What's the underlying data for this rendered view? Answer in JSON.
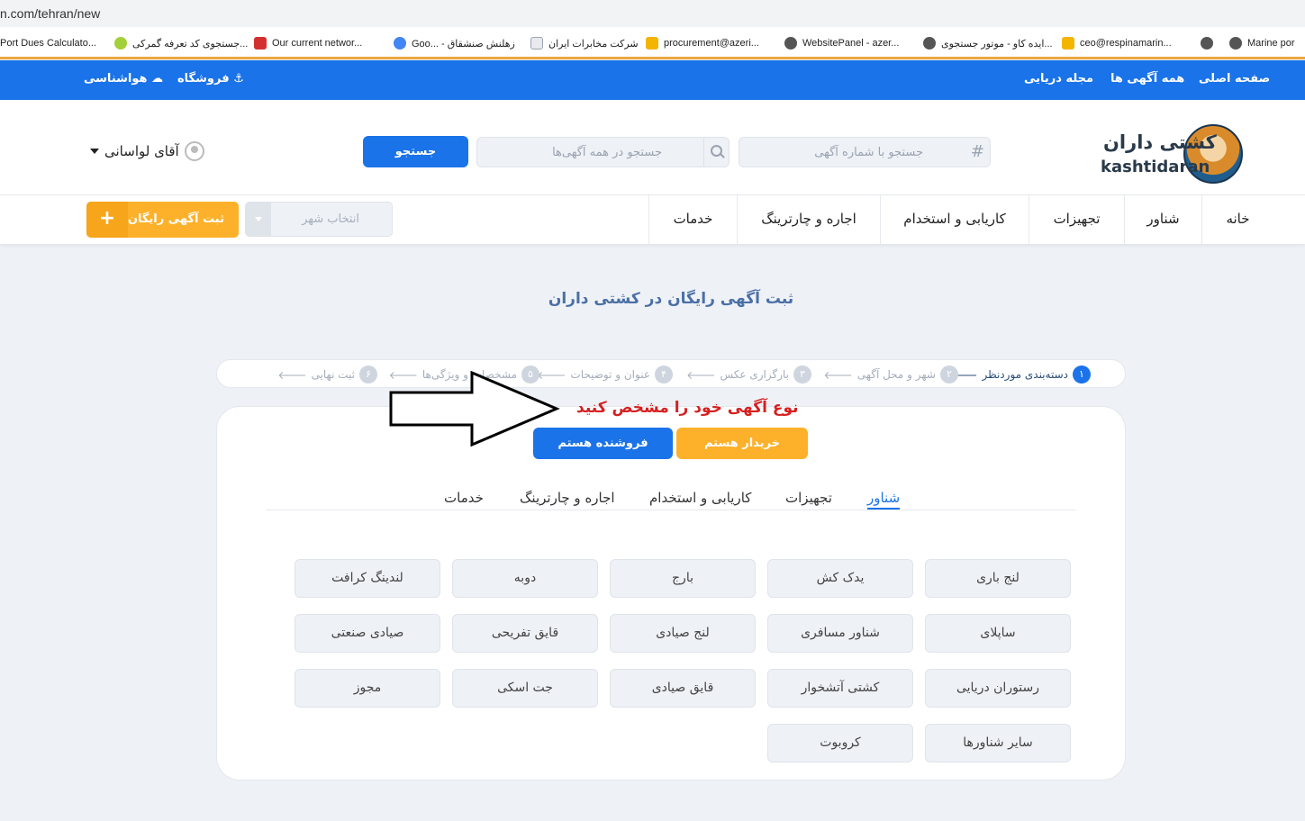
{
  "browser": {
    "url": "n.com/tehran/new",
    "bookmarks": [
      {
        "label": "Port Dues Calculato...",
        "color": "#ffffff"
      },
      {
        "label": "جستجوی کد تعرفه گمرکی...",
        "color": "#a3cf3a"
      },
      {
        "label": "Our current networ...",
        "color": "#d32f2f"
      },
      {
        "label": "Goo... - زهلنش صنشقاق",
        "color": "#4285f4"
      },
      {
        "label": "شرکت مخابرات ایران",
        "color": "#9aa3b0"
      },
      {
        "label": "procurement@azeri...",
        "color": "#f4b400"
      },
      {
        "label": "WebsitePanel - azer...",
        "color": "#555555"
      },
      {
        "label": "ایده کاو - موتور جستجوی...",
        "color": "#555555"
      },
      {
        "label": "ceo@respinamarin...",
        "color": "#f4b400"
      },
      {
        "label": "",
        "color": "#555555"
      },
      {
        "label": "Marine por",
        "color": "#555555"
      }
    ]
  },
  "topbar": {
    "weather": "هواشناسی",
    "shop": "فروشگاه",
    "magazine": "مجله دریایی",
    "all_ads": "همه آگهی ها",
    "home": "صفحه اصلی"
  },
  "header": {
    "logo_fa": "کشتی داران",
    "logo_en": "kashtidaran",
    "search_ad_placeholder": "جستجو با شماره آگهی",
    "search_all_placeholder": "جستجو در همه آگهی‌ها",
    "search_button": "جستجو",
    "user_name": "آقای لواسانی"
  },
  "nav": {
    "items": [
      "خانه",
      "شناور",
      "تجهیزات",
      "کاریابی و استخدام",
      "اجاره و چارترینگ",
      "خدمات"
    ],
    "city_placeholder": "انتخاب شهر",
    "post_button": "ثبت آگهی رایگان",
    "plus": "+"
  },
  "page": {
    "title": "ثبت آگهی رایگان در کشتی داران",
    "notice": "نوع آگهی خود را مشخص کنید",
    "buyer": "خریدار هستم",
    "seller": "فروشنده هستم"
  },
  "steps": [
    {
      "num": "۱",
      "label": "دسته‌بندی موردنظر",
      "active": true
    },
    {
      "num": "۲",
      "label": "شهر و محل آگهی",
      "active": false
    },
    {
      "num": "۳",
      "label": "بارگزاری عکس",
      "active": false
    },
    {
      "num": "۴",
      "label": "عنوان و توضیحات",
      "active": false
    },
    {
      "num": "۵",
      "label": "مشخصات و ویژگی‌ها",
      "active": false
    },
    {
      "num": "۶",
      "label": "ثبت نهایی",
      "active": false
    }
  ],
  "category_tabs": [
    "شناور",
    "تجهیزات",
    "کاریابی و استخدام",
    "اجاره و چارترینگ",
    "خدمات"
  ],
  "chips": [
    "لنج باری",
    "یدک کش",
    "بارج",
    "دوبه",
    "لندینگ کرافت",
    "ساپلای",
    "شناور مسافری",
    "لنج صیادی",
    "قایق تفریحی",
    "صیادی صنعتی",
    "رستوران دریایی",
    "کشتی آتشخوار",
    "قایق صیادی",
    "جت اسکی",
    "مجوز",
    "سایر شناورها",
    "کروبوت"
  ]
}
